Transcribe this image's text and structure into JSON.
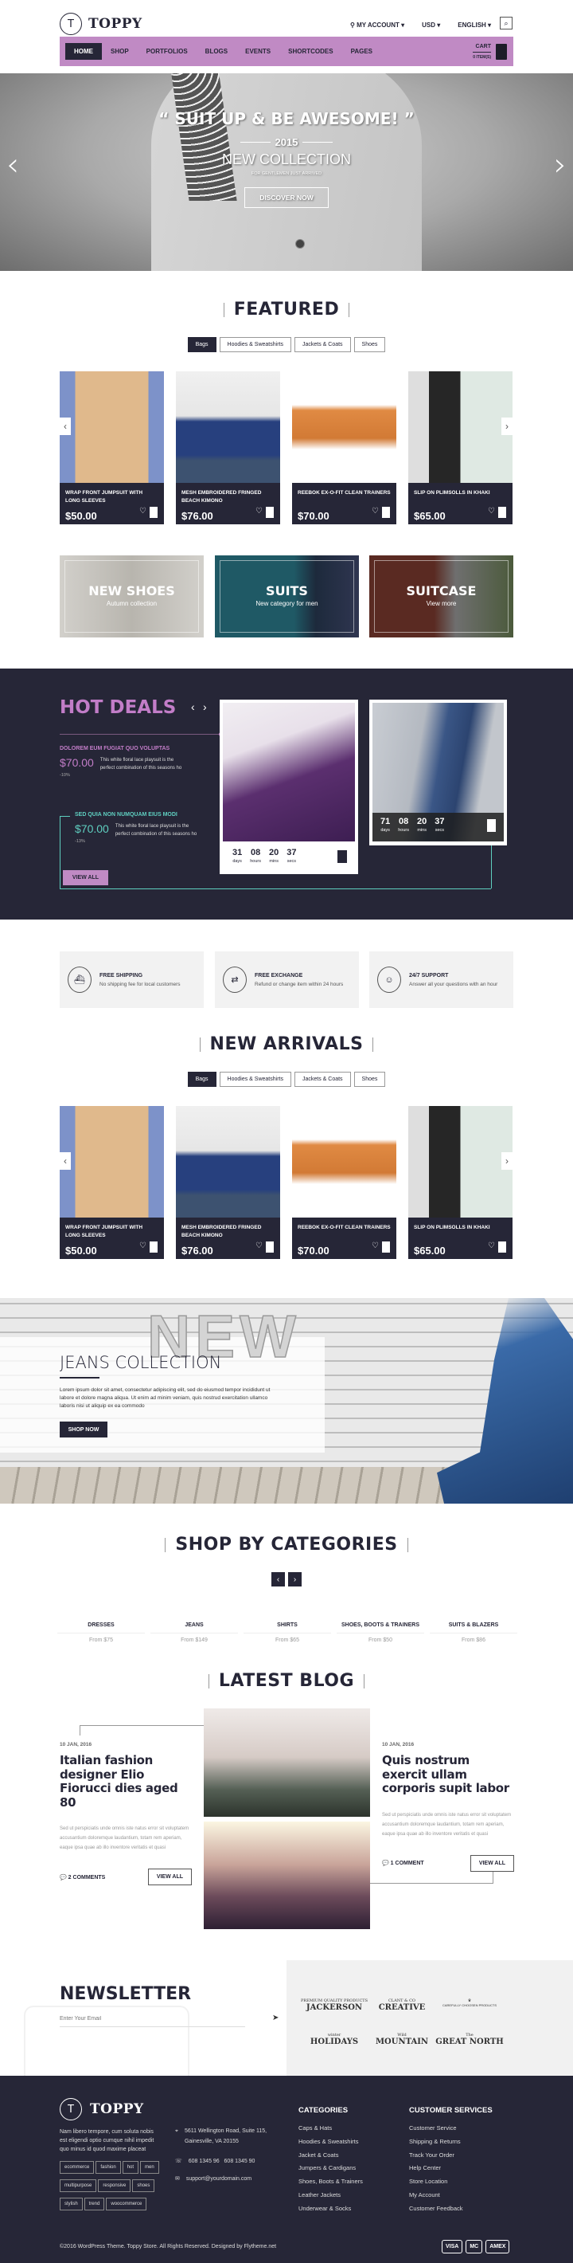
{
  "header": {
    "brand": "TOPPY",
    "logo_letter": "T",
    "account": "MY ACCOUNT",
    "currency": "USD",
    "language": "ENGLISH",
    "icons": {
      "account": "key-icon",
      "search": "search-icon"
    }
  },
  "nav": {
    "items": [
      "HOME",
      "SHOP",
      "PORTFOLIOS",
      "BLOGS",
      "EVENTS",
      "SHORTCODES",
      "PAGES"
    ],
    "active": "HOME",
    "cart_label": "CART",
    "cart_count": "0 ITEM(S)"
  },
  "hero": {
    "headline": "“ SUIT UP & BE AWESOME! ”",
    "year": "2015",
    "subtitle": "NEW COLLECTION",
    "tagline": "FOR GENTLEMEN JUST ARRIVED",
    "cta": "DISCOVER NOW"
  },
  "featured": {
    "title": "FEATURED",
    "tabs": [
      "Bags",
      "Hoodies & Sweatshirts",
      "Jackets & Coats",
      "Shoes"
    ],
    "active_tab": "Bags",
    "products": [
      {
        "name": "WRAP FRONT JUMPSUIT WITH LONG SLEEVES",
        "price": "$50.00"
      },
      {
        "name": "MESH EMBROIDERED FRINGED BEACH KIMONO",
        "price": "$76.00"
      },
      {
        "name": "REEBOK EX-O-FIT CLEAN TRAINERS",
        "price": "$70.00"
      },
      {
        "name": "SLIP ON PLIMSOLLS IN KHAKI",
        "price": "$65.00"
      }
    ]
  },
  "banners": [
    {
      "title": "NEW SHOES",
      "subtitle": "Autumn collection"
    },
    {
      "title": "SUITS",
      "subtitle": "New category for men"
    },
    {
      "title": "SUITCASE",
      "subtitle": "View more"
    }
  ],
  "hot_deals": {
    "title": "HOT DEALS",
    "items": [
      {
        "title": "DOLOREM EUM FUGIAT QUO VOLUPTAS",
        "price": "$70.00",
        "discount": "-10%",
        "desc": "This white floral lace playsuit is the perfect combination of this seasons ho"
      },
      {
        "title": "SED QUIA NON NUMQUAM EIUS MODI",
        "price": "$70.00",
        "discount": "-13%",
        "desc": "This white floral lace playsuit is the perfect combination of this seasons ho"
      }
    ],
    "view_all": "VIEW ALL",
    "countdowns": [
      {
        "days": "31",
        "hours": "08",
        "mins": "20",
        "secs": "37"
      },
      {
        "days": "71",
        "hours": "08",
        "mins": "20",
        "secs": "37"
      }
    ],
    "units": {
      "days": "days",
      "hours": "hours",
      "mins": "mins",
      "secs": "secs"
    },
    "colors": {
      "accent": "#c27dc8",
      "teal": "#5fcfc0",
      "bg": "#262637"
    }
  },
  "services": [
    {
      "icon": "ship-icon",
      "title": "FREE SHIPPING",
      "desc": "No shipping fee for local customers"
    },
    {
      "icon": "exchange-icon",
      "title": "FREE EXCHANGE",
      "desc": "Refund or change item within 24 hours"
    },
    {
      "icon": "support-icon",
      "title": "24/7 SUPPORT",
      "desc": "Answer all your questions with an hour"
    }
  ],
  "new_arrivals": {
    "title": "NEW ARRIVALS",
    "tabs": [
      "Bags",
      "Hoodies & Sweatshirts",
      "Jackets & Coats",
      "Shoes"
    ],
    "active_tab": "Bags",
    "products": [
      {
        "name": "WRAP FRONT JUMPSUIT WITH LONG SLEEVES",
        "price": "$50.00"
      },
      {
        "name": "MESH EMBROIDERED FRINGED BEACH KIMONO",
        "price": "$76.00"
      },
      {
        "name": "REEBOK EX-O-FIT CLEAN TRAINERS",
        "price": "$70.00"
      },
      {
        "name": "SLIP ON PLIMSOLLS IN KHAKI",
        "price": "$65.00"
      }
    ]
  },
  "jeans": {
    "watermark": "NEW",
    "title": "JEANS COLLECTION",
    "text": "Lorem ipsum dolor sit amet, consectetur adipiscing elit, sed do eiusmod tempor incididunt ut labore et dolore magna aliqua. Ut enim ad minim veniam, quis nostrud exercitation ullamco laboris nisi ut aliquip ex ea commodo",
    "cta": "SHOP NOW"
  },
  "categories": {
    "title": "SHOP BY CATEGORIES",
    "items": [
      {
        "name": "DRESSES",
        "from": "From $75"
      },
      {
        "name": "JEANS",
        "from": "From $149"
      },
      {
        "name": "SHIRTS",
        "from": "From $65"
      },
      {
        "name": "SHOES, BOOTS & TRAINERS",
        "from": "From $50"
      },
      {
        "name": "SUITS & BLAZERS",
        "from": "From $86"
      }
    ]
  },
  "blog": {
    "title": "LATEST BLOG",
    "posts": [
      {
        "date": "10 JAN, 2016",
        "title": "Italian fashion designer Elio Fiorucci dies aged 80",
        "excerpt": "Sed ut perspiciatis unde omnis iste natus error sit voluptatem accusantium doloremque laudantium, totam rem aperiam, eaque ipsa quae ab illo inventore veritatis et quasi",
        "comments": "2 COMMENTS",
        "cta": "VIEW ALL"
      },
      {
        "date": "10 JAN, 2016",
        "title": "Quis nostrum exercit ullam corporis supit labor",
        "excerpt": "Sed ut perspiciatis unde omnis iste natus error sit voluptatem accusantium doloremque laudantium, totam rem aperiam, eaque ipsa quae ab illo inventore veritatis et quasi",
        "comments": "1 COMMENT",
        "cta": "VIEW ALL"
      }
    ]
  },
  "newsletter": {
    "title": "NEWSLETTER",
    "placeholder": "Enter Your Email"
  },
  "brands": [
    {
      "name": "JACKERSON",
      "sub": "PREMIUM QUALITY PRODUCTS"
    },
    {
      "name": "CREATIVE",
      "sub": "CLANT & CO"
    },
    {
      "name": "CAREFULLY CHOOSEN PRODUCTS",
      "sub": "♛"
    },
    {
      "name": "HOLIDAYS",
      "sub": "winter"
    },
    {
      "name": "MOUNTAIN",
      "sub": "Wild"
    },
    {
      "name": "GREAT NORTH",
      "sub": "The"
    }
  ],
  "footer": {
    "brand": "TOPPY",
    "about": "Nam libero tempore, cum soluta nobis est eligendi optio cumque nihil impedit quo minus id quod maxime placeat",
    "tags": [
      "ecommerce",
      "fashion",
      "hot",
      "men",
      "multipurpose",
      "responsive",
      "shoes",
      "stylish",
      "trend",
      "woocommerce"
    ],
    "address": "5611 Wellington Road, Suite 115, Gainesville, VA 20155",
    "phone": "608 1345 96   608 1345 90",
    "email": "support@yourdomain.com",
    "categories_title": "CATEGORIES",
    "categories": [
      "Caps & Hats",
      "Hoodies & Sweatshirts",
      "Jacket & Coats",
      "Jumpers & Cardigans",
      "Shoes, Boots & Trainers",
      "Leather Jackets",
      "Underwear & Socks"
    ],
    "services_title": "CUSTOMER SERVICES",
    "services": [
      "Customer Service",
      "Shipping & Returns",
      "Track Your Order",
      "Help Center",
      "Store Location",
      "My Account",
      "Customer Feedback"
    ],
    "copyright": "©2016 WordPress Theme. Toppy Store. All Rights Reserved. Designed by Flytheme.net",
    "payments": [
      "VISA",
      "MC",
      "AMEX"
    ]
  }
}
